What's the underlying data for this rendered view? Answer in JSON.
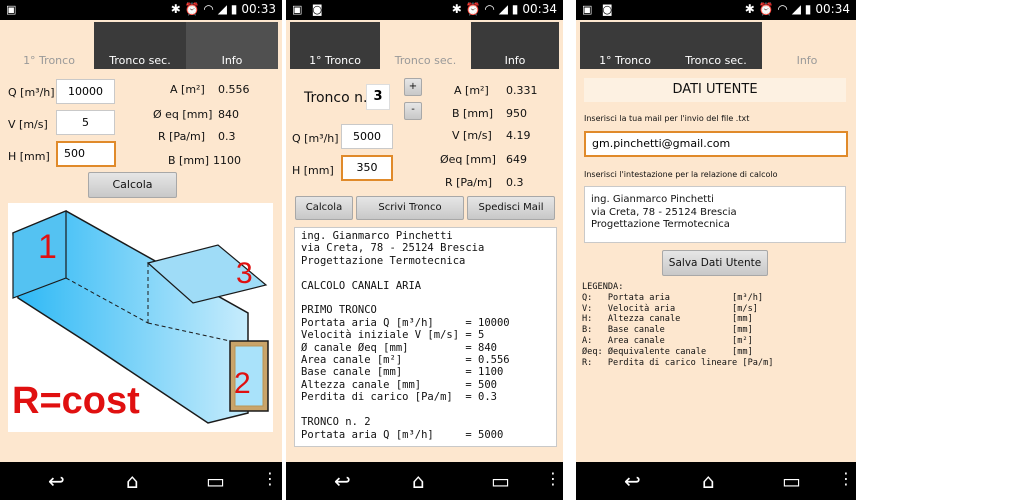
{
  "status": {
    "screen1_time": "00:33",
    "screen2_time": "00:34",
    "screen3_time": "00:34"
  },
  "tabs": {
    "tab1": "1° Tronco",
    "tab2": "Tronco sec.",
    "tab3": "Info"
  },
  "screen1": {
    "q_label": "Q [m³/h]",
    "q_value": "10000",
    "v_label": "V [m/s]",
    "v_value": "5",
    "h_label": "H [mm]",
    "h_value": "500",
    "a_label": "A [m²]",
    "a_value": "0.556",
    "deq_label": "Ø eq [mm]",
    "deq_value": "840",
    "r_label": "R [Pa/m]",
    "r_value": "0.3",
    "b_label": "B [mm]",
    "b_value": "1100",
    "calc_button": "Calcola",
    "diagram": {
      "label1": "1",
      "label2": "2",
      "label3": "3",
      "formula": "R=cost"
    }
  },
  "screen2": {
    "tronco_label": "Tronco n.",
    "tronco_value": "3",
    "plus": "+",
    "minus": "-",
    "a_label": "A [m²]",
    "a_value": "0.331",
    "b_label": "B [mm]",
    "b_value": "950",
    "v_label": "V [m/s]",
    "v_value": "4.19",
    "deq_label": "Øeq [mm]",
    "deq_value": "649",
    "r_label": "R [Pa/m]",
    "r_value": "0.3",
    "q_label": "Q [m³/h]",
    "q_value": "5000",
    "h_label": "H [mm]",
    "h_value": "350",
    "btn_calcola": "Calcola",
    "btn_scrivi": "Scrivi Tronco",
    "btn_mail": "Spedisci Mail",
    "report": "ing. Gianmarco Pinchetti\nvia Creta, 78 - 25124 Brescia\nProgettazione Termotecnica\n\nCALCOLO CANALI ARIA\n\nPRIMO TRONCO\nPortata aria Q [m³/h]     = 10000\nVelocità iniziale V [m/s] = 5\nØ canale Øeq [mm]         = 840\nArea canale [m²]          = 0.556\nBase canale [mm]          = 1100\nAltezza canale [mm]       = 500\nPerdita di carico [Pa/m]  = 0.3\n\nTRONCO n. 2\nPortata aria Q [m³/h]     = 5000"
  },
  "screen3": {
    "title": "DATI UTENTE",
    "mail_hint": "Inserisci la tua mail per l'invio del file .txt",
    "mail_value": "gm.pinchetti@gmail.com",
    "header_hint": "Inserisci l'intestazione per la relazione di calcolo",
    "header_value": "ing. Gianmarco Pinchetti\nvia Creta, 78 - 25124 Brescia\nProgettazione Termotecnica",
    "save_button": "Salva Dati Utente",
    "legend": "LEGENDA:\nQ:   Portata aria            [m³/h]\nV:   Velocità aria           [m/s]\nH:   Altezza canale          [mm]\nB:   Base canale             [mm]\nA:   Area canale             [m²]\nØeq: Øequivalente canale     [mm]\nR:   Perdita di carico lineare [Pa/m]"
  },
  "colors": {
    "background": "#fde7cf",
    "tab_dark": "#3a3a3a",
    "focus_border": "#e08a2a",
    "duct": "#5cc8f5",
    "label_red": "#e01010"
  },
  "icons": [
    "image-icon",
    "camera-icon",
    "bluetooth-icon",
    "alarm-icon",
    "wifi-icon",
    "signal-icon",
    "battery-icon",
    "back-icon",
    "home-icon",
    "recents-icon",
    "menu-icon"
  ]
}
